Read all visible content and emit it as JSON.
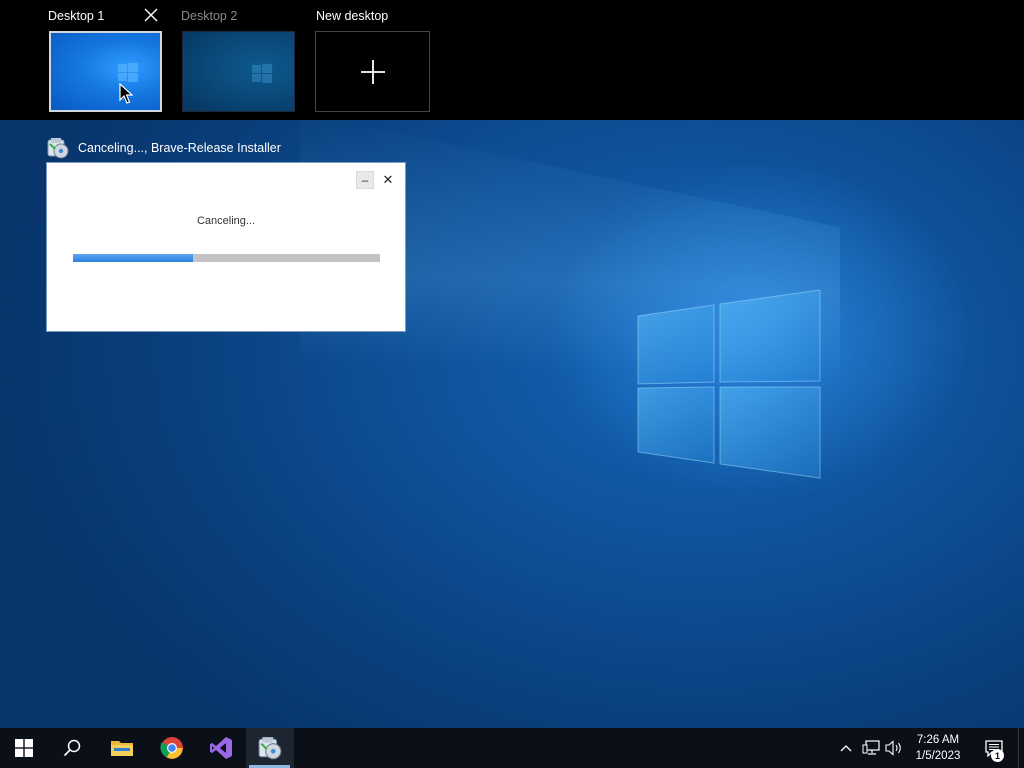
{
  "task_view": {
    "desktops": [
      {
        "label": "Desktop 1",
        "active": true
      },
      {
        "label": "Desktop 2",
        "active": false
      },
      {
        "label": "New desktop"
      }
    ],
    "close_icon": "close-icon",
    "add_icon": "plus-icon"
  },
  "window": {
    "caption": "Canceling..., Brave-Release Installer",
    "icon": "installer-icon",
    "dialog": {
      "minimize_label": "–",
      "close_label": "✕",
      "status": "Canceling...",
      "progress": 0.39
    }
  },
  "taskbar": {
    "items": [
      {
        "name": "start",
        "icon": "windows-icon"
      },
      {
        "name": "search",
        "icon": "search-icon"
      },
      {
        "name": "file-explorer",
        "icon": "folder-icon"
      },
      {
        "name": "chrome",
        "icon": "chrome-icon"
      },
      {
        "name": "visual-studio",
        "icon": "visual-studio-icon"
      },
      {
        "name": "installer",
        "icon": "installer-icon",
        "active": true
      }
    ],
    "tray": {
      "time": "7:26 AM",
      "date": "1/5/2023",
      "notification_count": "1"
    }
  },
  "colors": {
    "taskbar_bg": "#0b0f17",
    "progress_fill": "#2e82e0",
    "progress_track": "#c4c4c4",
    "wallpaper": "#0d4f95"
  }
}
